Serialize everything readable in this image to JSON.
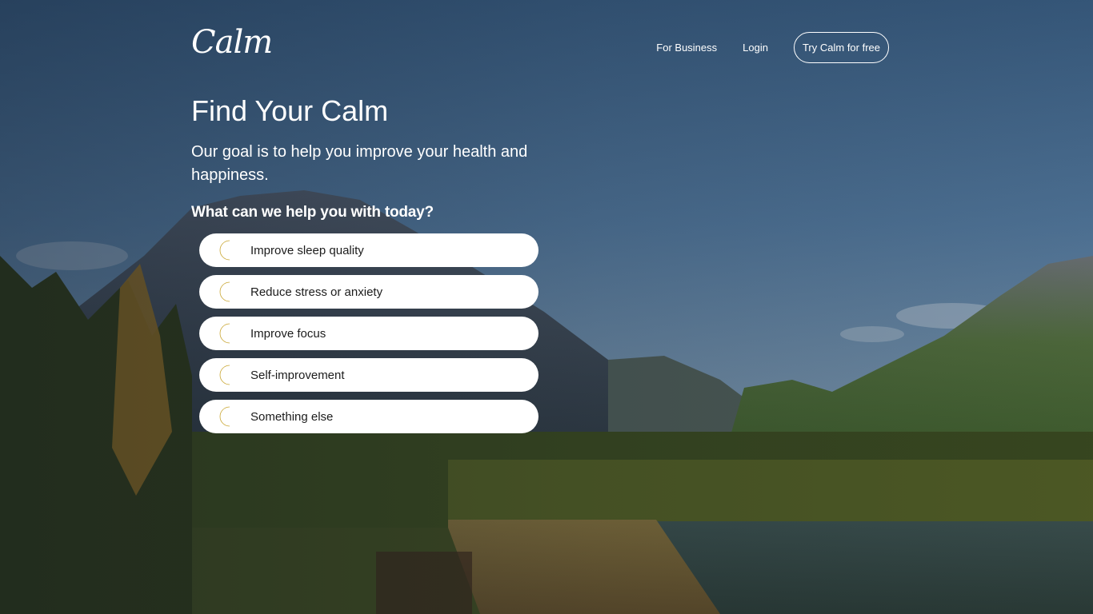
{
  "header": {
    "logo_text": "Calm",
    "nav": {
      "for_business": "For Business",
      "login": "Login",
      "cta": "Try Calm for free"
    }
  },
  "hero": {
    "title": "Find Your Calm",
    "subtitle": "Our goal is to help you improve your health and happiness.",
    "question": "What can we help you with today?"
  },
  "options": [
    {
      "label": "Improve sleep quality",
      "icon": "crescent-moon-icon"
    },
    {
      "label": "Reduce stress or anxiety",
      "icon": "crescent-moon-icon"
    },
    {
      "label": "Improve focus",
      "icon": "crescent-moon-icon"
    },
    {
      "label": "Self-improvement",
      "icon": "crescent-moon-icon"
    },
    {
      "label": "Something else",
      "icon": "crescent-moon-icon"
    }
  ],
  "colors": {
    "moon": "#e9c84a",
    "option_bg": "#ffffff",
    "text_light": "#ffffff",
    "text_dark": "#1c1c1c"
  },
  "background": {
    "description_icon": "mountain-lake-landscape"
  }
}
